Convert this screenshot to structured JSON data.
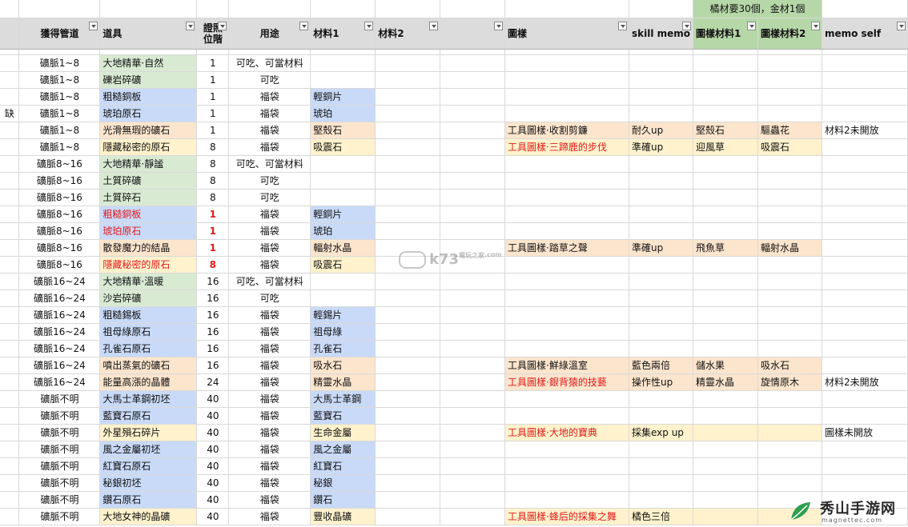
{
  "note": "橘材要30個，金材1個",
  "headers": [
    "獲得管道",
    "道具",
    "證照位階",
    "用途",
    "材料1",
    "材料2",
    "",
    "圖樣",
    "skill memo",
    "圖樣材料1",
    "圖樣材料2",
    "memo self"
  ],
  "rows": [
    {
      "a": "",
      "src": "礦脈1~8",
      "item": "大地精華·自然",
      "rank": "1",
      "use": "可吃、可當材料",
      "m1": "",
      "m2": "",
      "x": "",
      "pat": "",
      "skill": "",
      "pm1": "",
      "pm2": "",
      "memo": ""
    },
    {
      "a": "",
      "src": "礦脈1~8",
      "item": "礫岩碎礦",
      "rank": "1",
      "use": "可吃",
      "m1": "",
      "m2": "",
      "x": "",
      "pat": "",
      "skill": "",
      "pm1": "",
      "pm2": "",
      "memo": ""
    },
    {
      "a": "",
      "src": "礦脈1~8",
      "item": "粗糙銅板",
      "rank": "1",
      "use": "福袋",
      "m1": "輕銅片",
      "m2": "",
      "x": "",
      "pat": "",
      "skill": "",
      "pm1": "",
      "pm2": "",
      "memo": ""
    },
    {
      "a": "缺",
      "src": "礦脈1~8",
      "item": "琥珀原石",
      "rank": "1",
      "use": "福袋",
      "m1": "琥珀",
      "m2": "",
      "x": "",
      "pat": "",
      "skill": "",
      "pm1": "",
      "pm2": "",
      "memo": ""
    },
    {
      "a": "",
      "src": "礦脈1~8",
      "item": "光滑無瑕的礦石",
      "rank": "1",
      "use": "福袋",
      "m1": "堅殼石",
      "m2": "",
      "x": "",
      "pat": "工具圖樣·收割剪鐮",
      "skill": "耐久up",
      "pm1": "堅殼石",
      "pm2": "驅蟲花",
      "memo": "材料2未開放"
    },
    {
      "a": "",
      "src": "礦脈1~8",
      "item": "隱藏秘密的原石",
      "rank": "8",
      "use": "福袋",
      "m1": "吸震石",
      "m2": "",
      "x": "",
      "pat": "工具圖樣·三蹄鹿的步伐",
      "skill": "準確up",
      "pm1": "迎風草",
      "pm2": "吸震石",
      "memo": ""
    },
    {
      "a": "",
      "src": "礦脈8~16",
      "item": "大地精華·靜謐",
      "rank": "8",
      "use": "可吃、可當材料",
      "m1": "",
      "m2": "",
      "x": "",
      "pat": "",
      "skill": "",
      "pm1": "",
      "pm2": "",
      "memo": ""
    },
    {
      "a": "",
      "src": "礦脈8~16",
      "item": "土質碎礦",
      "rank": "8",
      "use": "可吃",
      "m1": "",
      "m2": "",
      "x": "",
      "pat": "",
      "skill": "",
      "pm1": "",
      "pm2": "",
      "memo": ""
    },
    {
      "a": "",
      "src": "礦脈8~16",
      "item": "土質碎石",
      "rank": "8",
      "use": "可吃",
      "m1": "",
      "m2": "",
      "x": "",
      "pat": "",
      "skill": "",
      "pm1": "",
      "pm2": "",
      "memo": ""
    },
    {
      "a": "",
      "src": "礦脈8~16",
      "item": "粗糙銅板",
      "rank": "1",
      "use": "福袋",
      "m1": "輕銅片",
      "m2": "",
      "x": "",
      "pat": "",
      "skill": "",
      "pm1": "",
      "pm2": "",
      "memo": ""
    },
    {
      "a": "",
      "src": "礦脈8~16",
      "item": "琥珀原石",
      "rank": "1",
      "use": "福袋",
      "m1": "琥珀",
      "m2": "",
      "x": "",
      "pat": "",
      "skill": "",
      "pm1": "",
      "pm2": "",
      "memo": ""
    },
    {
      "a": "",
      "src": "礦脈8~16",
      "item": "散發魔力的結晶",
      "rank": "1",
      "use": "福袋",
      "m1": "輻射水晶",
      "m2": "",
      "x": "",
      "pat": "工具圖樣·踏草之聲",
      "skill": "準確up",
      "pm1": "飛魚草",
      "pm2": "輻射水晶",
      "memo": ""
    },
    {
      "a": "",
      "src": "礦脈8~16",
      "item": "隱藏秘密的原石",
      "rank": "8",
      "use": "福袋",
      "m1": "吸震石",
      "m2": "",
      "x": "",
      "pat": "",
      "skill": "",
      "pm1": "",
      "pm2": "",
      "memo": ""
    },
    {
      "a": "",
      "src": "礦脈16~24",
      "item": "大地精華·溫暖",
      "rank": "16",
      "use": "可吃、可當材料",
      "m1": "",
      "m2": "",
      "x": "",
      "pat": "",
      "skill": "",
      "pm1": "",
      "pm2": "",
      "memo": ""
    },
    {
      "a": "",
      "src": "礦脈16~24",
      "item": "沙岩碎礦",
      "rank": "16",
      "use": "可吃",
      "m1": "",
      "m2": "",
      "x": "",
      "pat": "",
      "skill": "",
      "pm1": "",
      "pm2": "",
      "memo": ""
    },
    {
      "a": "",
      "src": "礦脈16~24",
      "item": "粗糙錫板",
      "rank": "16",
      "use": "福袋",
      "m1": "輕錫片",
      "m2": "",
      "x": "",
      "pat": "",
      "skill": "",
      "pm1": "",
      "pm2": "",
      "memo": ""
    },
    {
      "a": "",
      "src": "礦脈16~24",
      "item": "祖母綠原石",
      "rank": "16",
      "use": "福袋",
      "m1": "祖母綠",
      "m2": "",
      "x": "",
      "pat": "",
      "skill": "",
      "pm1": "",
      "pm2": "",
      "memo": ""
    },
    {
      "a": "",
      "src": "礦脈16~24",
      "item": "孔雀石原石",
      "rank": "16",
      "use": "福袋",
      "m1": "孔雀石",
      "m2": "",
      "x": "",
      "pat": "",
      "skill": "",
      "pm1": "",
      "pm2": "",
      "memo": ""
    },
    {
      "a": "",
      "src": "礦脈16~24",
      "item": "噴出蒸氣的礦石",
      "rank": "16",
      "use": "福袋",
      "m1": "吸水石",
      "m2": "",
      "x": "",
      "pat": "工具圖樣·鮮綠溫室",
      "skill": "藍色兩倍",
      "pm1": "儲水果",
      "pm2": "吸水石",
      "memo": ""
    },
    {
      "a": "",
      "src": "礦脈16~24",
      "item": "能量高漲的晶體",
      "rank": "24",
      "use": "福袋",
      "m1": "精靈水晶",
      "m2": "",
      "x": "",
      "pat": "工具圖樣·銀背猿的技藝",
      "skill": "操作性up",
      "pm1": "精靈水晶",
      "pm2": "旋情原木",
      "memo": "材料2未開放"
    },
    {
      "a": "",
      "src": "礦脈不明",
      "item": "大馬士革鋼初坯",
      "rank": "40",
      "use": "福袋",
      "m1": "大馬士革鋼",
      "m2": "",
      "x": "",
      "pat": "",
      "skill": "",
      "pm1": "",
      "pm2": "",
      "memo": ""
    },
    {
      "a": "",
      "src": "礦脈不明",
      "item": "藍寶石原石",
      "rank": "40",
      "use": "福袋",
      "m1": "藍寶石",
      "m2": "",
      "x": "",
      "pat": "",
      "skill": "",
      "pm1": "",
      "pm2": "",
      "memo": ""
    },
    {
      "a": "",
      "src": "礦脈不明",
      "item": "外星殞石碎片",
      "rank": "40",
      "use": "福袋",
      "m1": "生命金屬",
      "m2": "",
      "x": "",
      "pat": "工具圖樣·大地的寶典",
      "skill": "採集exp up",
      "pm1": "",
      "pm2": "",
      "memo": "圖樣未開放"
    },
    {
      "a": "",
      "src": "礦脈不明",
      "item": "風之金屬初坯",
      "rank": "40",
      "use": "福袋",
      "m1": "風之金屬",
      "m2": "",
      "x": "",
      "pat": "",
      "skill": "",
      "pm1": "",
      "pm2": "",
      "memo": ""
    },
    {
      "a": "",
      "src": "礦脈不明",
      "item": "紅寶石原石",
      "rank": "40",
      "use": "福袋",
      "m1": "紅寶石",
      "m2": "",
      "x": "",
      "pat": "",
      "skill": "",
      "pm1": "",
      "pm2": "",
      "memo": ""
    },
    {
      "a": "",
      "src": "礦脈不明",
      "item": "秘銀初坯",
      "rank": "40",
      "use": "福袋",
      "m1": "秘銀",
      "m2": "",
      "x": "",
      "pat": "",
      "skill": "",
      "pm1": "",
      "pm2": "",
      "memo": ""
    },
    {
      "a": "",
      "src": "礦脈不明",
      "item": "鑽石原石",
      "rank": "40",
      "use": "福袋",
      "m1": "鑽石",
      "m2": "",
      "x": "",
      "pat": "",
      "skill": "",
      "pm1": "",
      "pm2": "",
      "memo": ""
    },
    {
      "a": "",
      "src": "礦脈不明",
      "item": "大地女神的晶礦",
      "rank": "40",
      "use": "福袋",
      "m1": "豐收晶礦",
      "m2": "",
      "x": "",
      "pat": "工具圖樣·蜂后的採集之舞",
      "skill": "橘色三倍",
      "pm1": "",
      "pm2": "",
      "memo": ""
    }
  ],
  "watermark_1": {
    "main": "k73",
    "sub": "電玩之家",
    "domain": ".com"
  },
  "watermark_2": {
    "name": "秀山手游网",
    "domain": "magnettec.com"
  }
}
